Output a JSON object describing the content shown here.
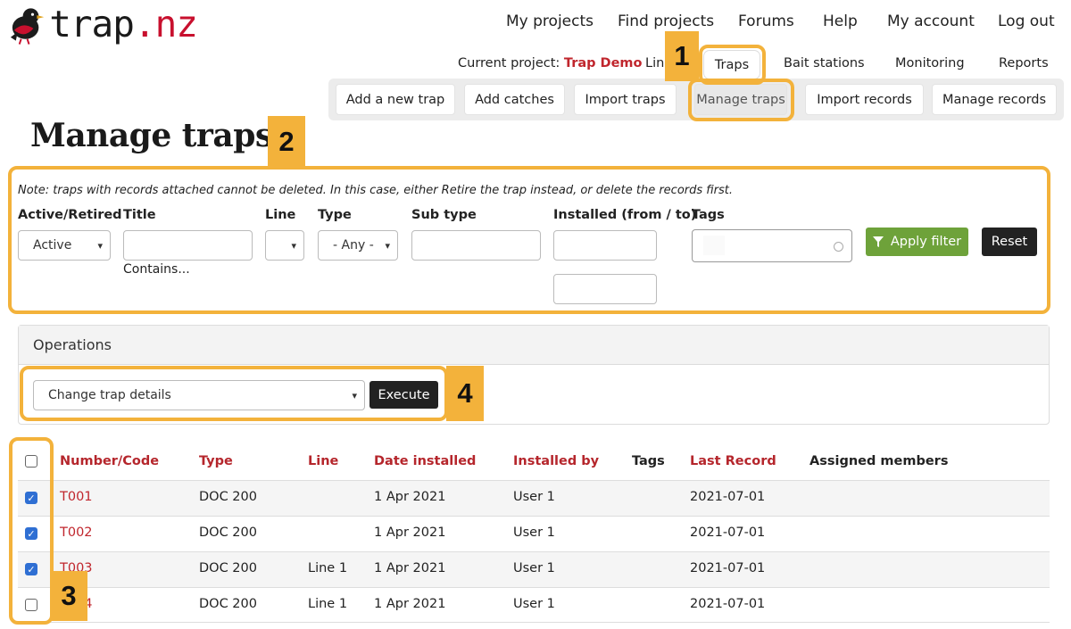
{
  "brand": {
    "name_main": "trap",
    "name_tld": ".nz",
    "accent": "#c8102e",
    "logo_icon": "bird-icon"
  },
  "top_nav": [
    "My projects",
    "Find projects",
    "Forums",
    "Help",
    "My account",
    "Log out"
  ],
  "project_bar": {
    "label": "Current project:",
    "project_name": "Trap Demo",
    "tabs": [
      "Lin",
      "Traps",
      "Bait stations",
      "Monitoring",
      "Reports"
    ]
  },
  "sub_nav": [
    "Add a new trap",
    "Add catches",
    "Import traps",
    "Manage traps",
    "Import records",
    "Manage records"
  ],
  "page_title": "Manage traps",
  "filter": {
    "note": "Note: traps with records attached cannot be deleted. In this case, either Retire the trap instead, or delete the records first.",
    "labels": {
      "active": "Active/Retired",
      "title": "Title",
      "line": "Line",
      "type": "Type",
      "subtype": "Sub type",
      "installed": "Installed (from / to)",
      "tags": "Tags"
    },
    "active_value": "Active",
    "type_value": "- Any -",
    "contains_hint": "Contains...",
    "apply_label": "Apply filter",
    "reset_label": "Reset"
  },
  "operations": {
    "title": "Operations",
    "selected_op": "Change trap details",
    "execute_label": "Execute"
  },
  "table": {
    "headers": [
      "Number/Code",
      "Type",
      "Line",
      "Date installed",
      "Installed by",
      "Tags",
      "Last Record",
      "Assigned members"
    ],
    "rows": [
      {
        "code": "T001",
        "type": "DOC 200",
        "line": "",
        "date": "1 Apr 2021",
        "by": "User 1",
        "tags": "",
        "last": "2021-07-01",
        "members": "",
        "checked": true
      },
      {
        "code": "T002",
        "type": "DOC 200",
        "line": "",
        "date": "1 Apr 2021",
        "by": "User 1",
        "tags": "",
        "last": "2021-07-01",
        "members": "",
        "checked": true
      },
      {
        "code": "T003",
        "type": "DOC 200",
        "line": "Line 1",
        "date": "1 Apr 2021",
        "by": "User 1",
        "tags": "",
        "last": "2021-07-01",
        "members": "",
        "checked": true
      },
      {
        "code": "T004",
        "type": "DOC 200",
        "line": "Line 1",
        "date": "1 Apr 2021",
        "by": "User 1",
        "tags": "",
        "last": "2021-07-01",
        "members": "",
        "checked": false
      }
    ]
  },
  "callouts": [
    "1",
    "2",
    "3",
    "4"
  ],
  "colors": {
    "highlight": "#f3b23b",
    "link_red": "#c0262d",
    "apply_green": "#6ea23a",
    "checkbox_blue": "#2f6fd3"
  }
}
